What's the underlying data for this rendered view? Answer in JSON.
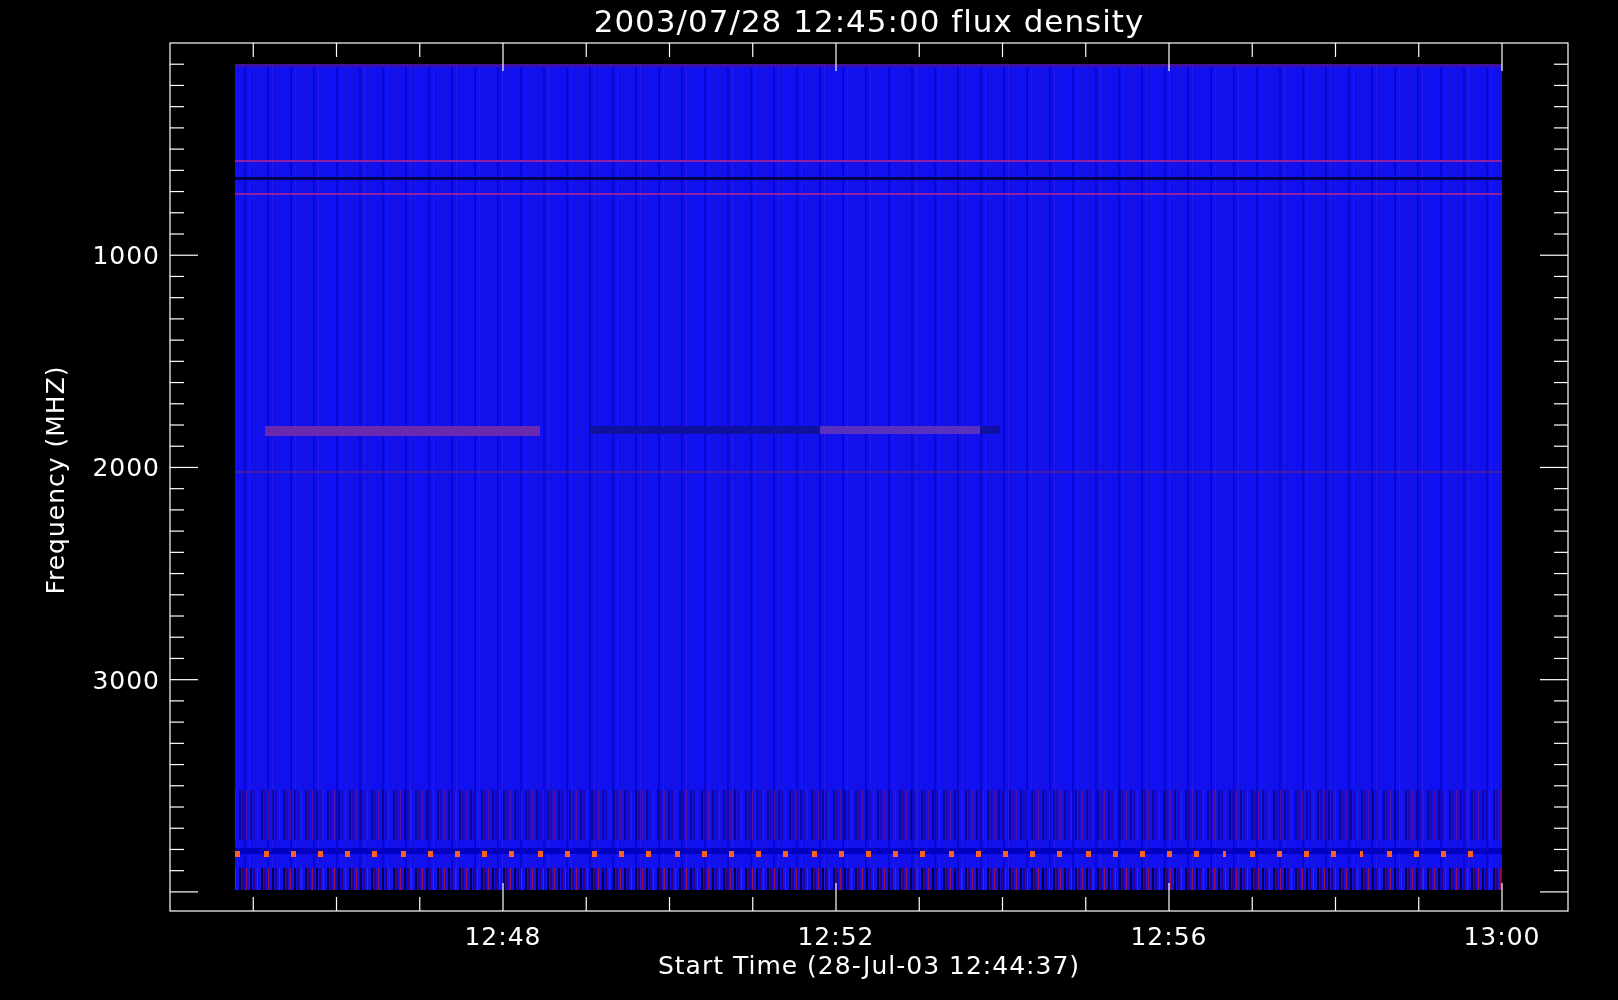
{
  "title": "2003/07/28 12:45:00 flux density",
  "y_axis": {
    "label": "Frequency (MHZ)",
    "ticks": [
      "1000",
      "2000",
      "3000"
    ]
  },
  "x_axis": {
    "label": "Start Time (28-Jul-03 12:44:37)",
    "ticks": [
      "12:48",
      "12:52",
      "12:56",
      "13:00"
    ]
  }
}
